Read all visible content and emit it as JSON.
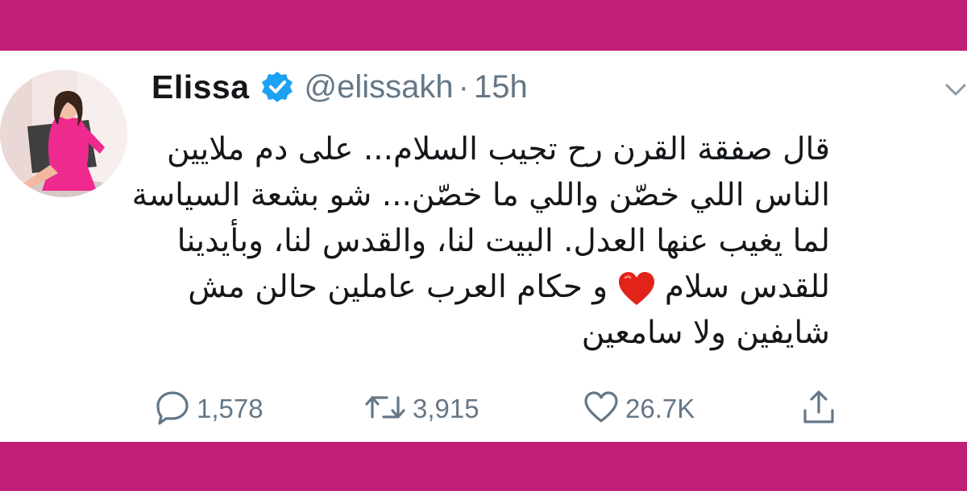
{
  "tweet": {
    "author_name": "Elissa",
    "handle": "@elissakh",
    "separator": "·",
    "time": "15h",
    "lines": [
      "قال صفقة القرن رح تجيب السلام... على دم ملايين",
      "الناس اللي خصّن واللي ما خصّن... شو بشعة السياسة",
      "لما يغيب عنها العدل. البيت لنا، والقدس لنا، وبأيدينا",
      "و حكام العرب عاملين حالن مش",
      "شايفين ولا سامعين"
    ],
    "line4_start": "للقدس سلام",
    "stats": {
      "replies": "1,578",
      "retweets": "3,915",
      "likes": "26.7K"
    },
    "icons": [
      "verified-badge-icon",
      "chevron-down-icon",
      "reply-icon",
      "retweet-icon",
      "heart-icon",
      "share-icon",
      "red-heart-emoji"
    ]
  },
  "colors": {
    "background_frame": "#c01f77",
    "card": "#ffffff",
    "verified": "#1da1f2",
    "muted": "#657786",
    "text": "#14171a"
  }
}
